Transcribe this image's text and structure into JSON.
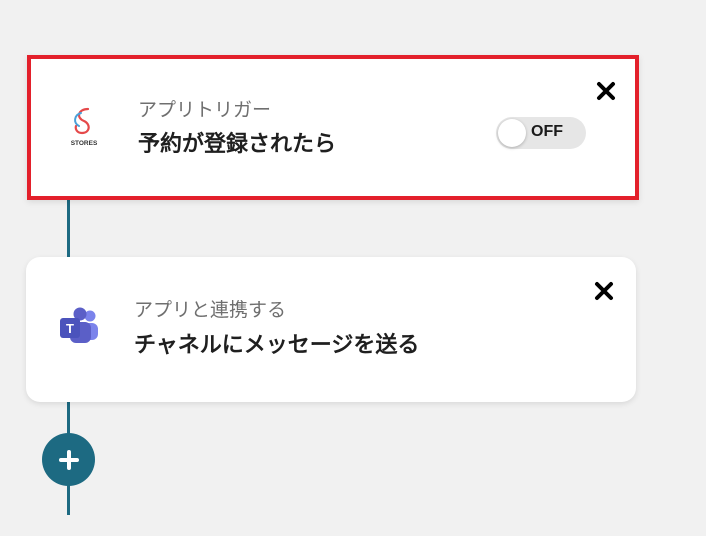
{
  "flow": {
    "steps": [
      {
        "subtitle": "アプリトリガー",
        "title": "予約が登録されたら",
        "app_icon": "stores-logo-icon",
        "app_icon_text": "STORES",
        "toggle": {
          "state_label": "OFF",
          "on": false
        },
        "close_icon": "close-icon"
      },
      {
        "subtitle": "アプリと連携する",
        "title": "チャネルにメッセージを送る",
        "app_icon": "microsoft-teams-icon",
        "app_icon_text": "T",
        "close_icon": "close-icon"
      }
    ],
    "add_button_icon": "plus-icon"
  },
  "colors": {
    "connector": "#1d6a82",
    "highlight_border": "#e3202b",
    "teams_purple": "#5b5fc7"
  }
}
